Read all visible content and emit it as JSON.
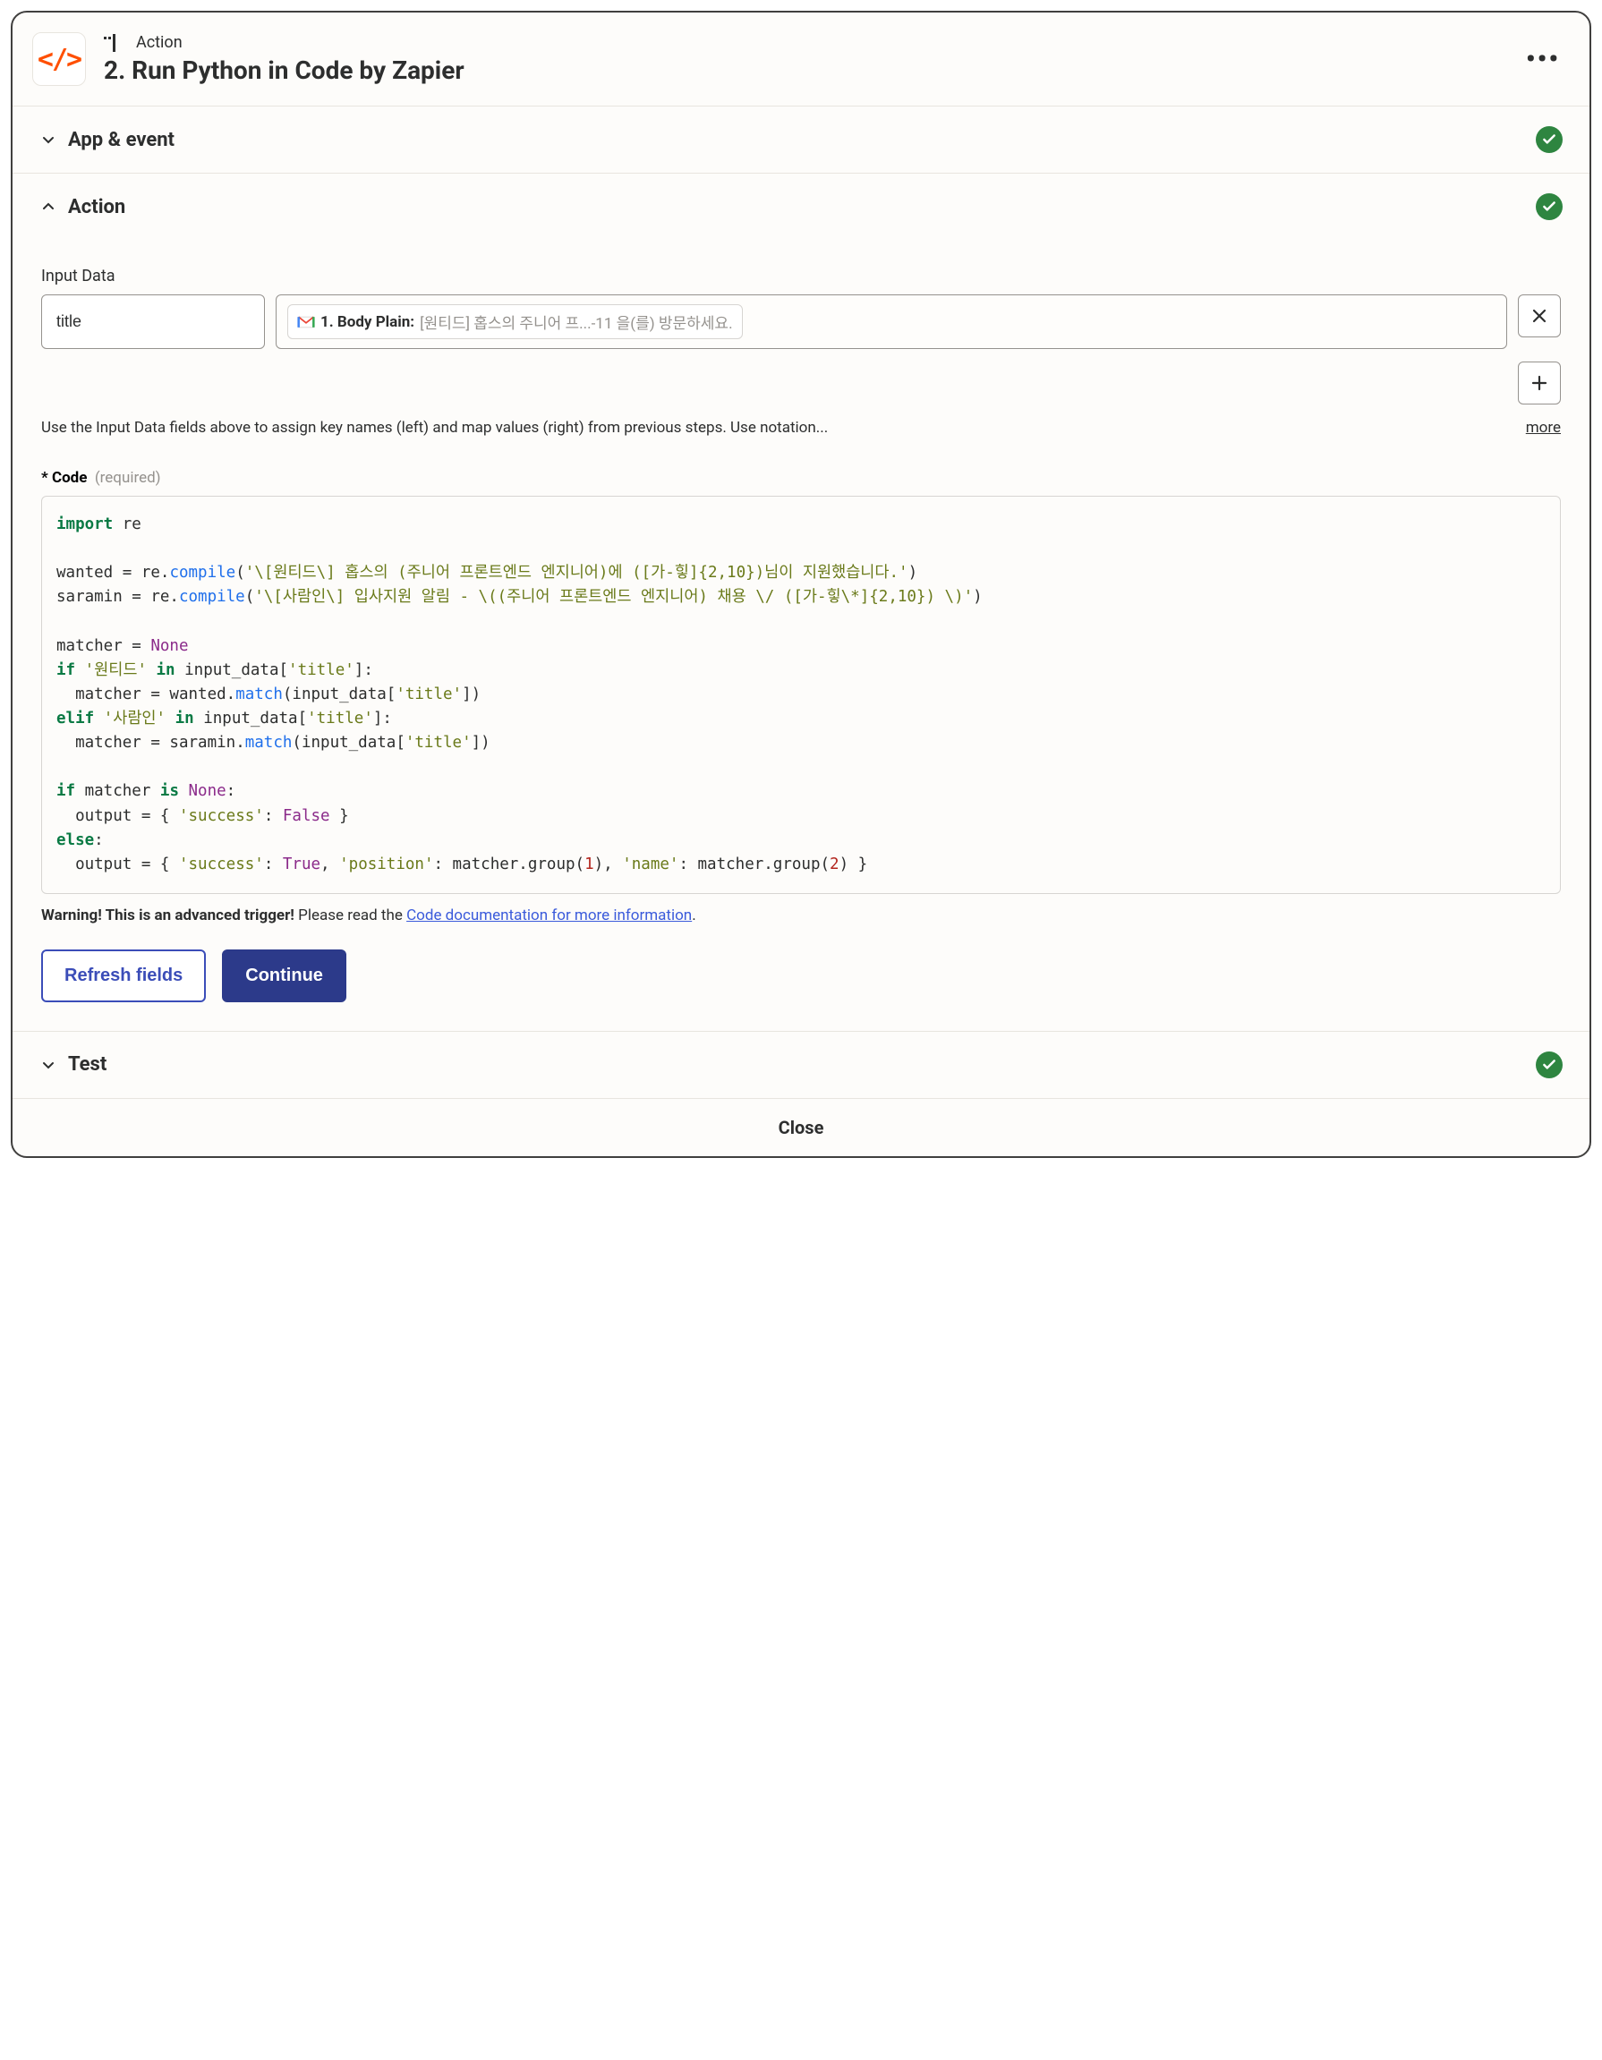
{
  "header": {
    "step_type": "Action",
    "title": "2. Run Python in Code by Zapier"
  },
  "sections": {
    "app_event": {
      "title": "App & event"
    },
    "action": {
      "title": "Action"
    },
    "test": {
      "title": "Test"
    }
  },
  "action_body": {
    "input_data_label": "Input Data",
    "key_value": "title",
    "token_label": "1. Body Plain:",
    "token_preview": "[원티드] 홉스의 주니어 프...-11 을(를) 방문하세요.",
    "help_text": "Use the Input Data fields above to assign key names (left) and map values (right) from previous steps. Use notation...",
    "more_link": "more",
    "code_label_prefix": "* Code",
    "code_label_required": "(required)",
    "code": {
      "l1_kw": "import",
      "l1_mod": " re",
      "l3_var": "wanted = re.",
      "l3_fn": "compile",
      "l3_open": "(",
      "l3_str": "'\\[원티드\\] 홉스의 (주니어 프론트엔드 엔지니어)에 ([가-힣]{2,10})님이 지원했습니다.'",
      "l3_close": ")",
      "l4_var": "saramin = re.",
      "l4_fn": "compile",
      "l4_open": "(",
      "l4_str": "'\\[사람인\\] 입사지원 알림 - \\((주니어 프론트엔드 엔지니어) 채용 \\/ ([가-힣\\*]{2,10}) \\)'",
      "l4_close": ")",
      "l6_var": "matcher = ",
      "l6_none": "None",
      "l7_if": "if ",
      "l7_str": "'원티드'",
      "l7_in": " in",
      "l7_rest": " input_data[",
      "l7_key": "'title'",
      "l7_end": "]:",
      "l8_pre": "  matcher = wanted.",
      "l8_fn": "match",
      "l8_open": "(input_data[",
      "l8_key": "'title'",
      "l8_close": "])",
      "l9_elif": "elif ",
      "l9_str": "'사람인'",
      "l9_in": " in",
      "l9_rest": " input_data[",
      "l9_key": "'title'",
      "l9_end": "]:",
      "l10_pre": "  matcher = saramin.",
      "l10_fn": "match",
      "l10_open": "(input_data[",
      "l10_key": "'title'",
      "l10_close": "])",
      "l12_if": "if",
      "l12_rest": " matcher ",
      "l12_is": "is ",
      "l12_none": "None",
      "l12_colon": ":",
      "l13_pre": "  output = { ",
      "l13_key": "'success'",
      "l13_mid": ": ",
      "l13_val": "False",
      "l13_end": " }",
      "l14_else": "else",
      "l14_colon": ":",
      "l15_pre": "  output = { ",
      "l15_k1": "'success'",
      "l15_m1": ": ",
      "l15_v1": "True",
      "l15_m2": ", ",
      "l15_k2": "'position'",
      "l15_m3": ": matcher.group(",
      "l15_n1": "1",
      "l15_m4": "), ",
      "l15_k3": "'name'",
      "l15_m5": ": matcher.group(",
      "l15_n2": "2",
      "l15_m6": ") }"
    },
    "warning_bold": "Warning! This is an advanced trigger!",
    "warning_mid": " Please read the ",
    "warning_link": "Code documentation for more information",
    "warning_period": ".",
    "refresh_btn": "Refresh fields",
    "continue_btn": "Continue"
  },
  "footer": {
    "close": "Close"
  }
}
